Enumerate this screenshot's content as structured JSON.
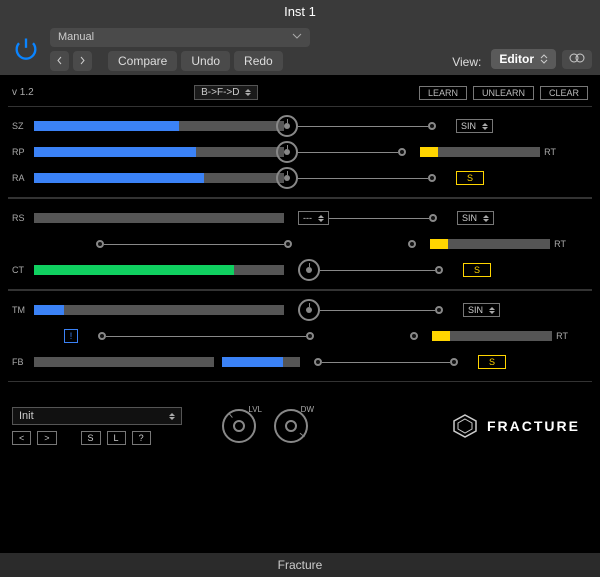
{
  "window_title": "Inst 1",
  "toolbar": {
    "preset_mode": "Manual",
    "compare": "Compare",
    "undo": "Undo",
    "redo": "Redo",
    "view_label": "View:",
    "view_value": "Editor"
  },
  "plugin": {
    "version": "v 1.2",
    "routing": "B->F->D",
    "midi": {
      "learn": "LEARN",
      "unlearn": "UNLEARN",
      "clear": "CLEAR"
    },
    "lfo_wave": "SIN",
    "sync_label": "S",
    "rate_label": "RT",
    "section1": {
      "r1_label": "SZ",
      "r2_label": "RP",
      "r3_label": "RA"
    },
    "section2": {
      "r1_label": "RS",
      "r2_label": "CT",
      "seg_select": "---"
    },
    "section3": {
      "r1_label": "TM",
      "r2_label": "FB",
      "exclaim": "!"
    },
    "bottom": {
      "preset_name": "Init",
      "prev": "<",
      "next": ">",
      "save": "S",
      "load": "L",
      "help": "?",
      "lvl_label": "LVL",
      "dw_label": "DW",
      "brand": "FRACTURE"
    }
  },
  "footer": "Fracture"
}
